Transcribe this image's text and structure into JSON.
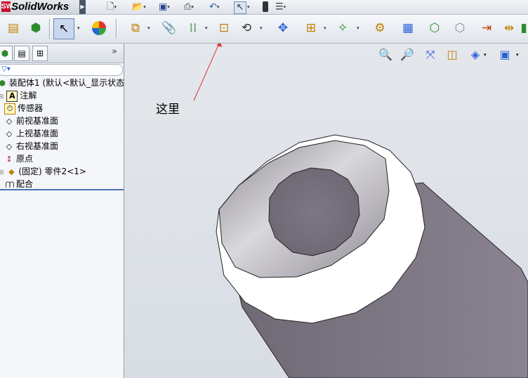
{
  "app": {
    "logo_mark": "SW",
    "title": "SolidWorks"
  },
  "quick_access": [
    "new-document",
    "open-folder",
    "save",
    "print",
    "undo",
    "select-pointer",
    "rebuild-traffic-light",
    "options"
  ],
  "command_toolbar": [
    "assembly-properties",
    "component-insert",
    "select-arrow",
    "appearance-ball",
    "insert-components",
    "paperclip-mate",
    "linear-pattern",
    "smart-fasteners",
    "move-component",
    "exploded-view",
    "show-hidden",
    "assembly-features",
    "reference-geometry",
    "new-motion-study",
    "bill-of-materials",
    "rebuild",
    "interference-detection",
    "clearance",
    "hole-alignment",
    "extra-button"
  ],
  "panel": {
    "tabs": [
      "feature-manager-tab",
      "property-manager-tab",
      "configuration-manager-tab"
    ],
    "expand_symbol": "»",
    "filter_symbol": "▽▾",
    "tree": [
      {
        "label": "装配体1 (默认<默认_显示状态",
        "icon": "assembly-icon"
      },
      {
        "label": "注解",
        "icon": "annotations-icon",
        "glyph": "A"
      },
      {
        "label": "传感器",
        "icon": "sensor-icon",
        "glyph": "⏱"
      },
      {
        "label": "前视基准面",
        "icon": "plane-icon",
        "glyph": "◇"
      },
      {
        "label": "上视基准面",
        "icon": "plane-icon",
        "glyph": "◇"
      },
      {
        "label": "右视基准面",
        "icon": "plane-icon",
        "glyph": "◇"
      },
      {
        "label": "原点",
        "icon": "origin-icon",
        "glyph": "↕"
      },
      {
        "label": "(固定) 零件2<1>",
        "icon": "part-icon",
        "glyph": "◆"
      },
      {
        "label": "配合",
        "icon": "mates-icon",
        "glyph": "⋂⋂"
      }
    ]
  },
  "viewport": {
    "view_tools": [
      "zoom-to-fit",
      "zoom-to-area",
      "previous-view",
      "section-view",
      "view-orientation",
      "display-style"
    ],
    "annotation": {
      "text": "这里"
    },
    "colors": {
      "tube_body": "#7f7883",
      "tube_face": "#ffffff",
      "inner_wall": "#9b96a0",
      "arrow": "#e53030"
    }
  }
}
